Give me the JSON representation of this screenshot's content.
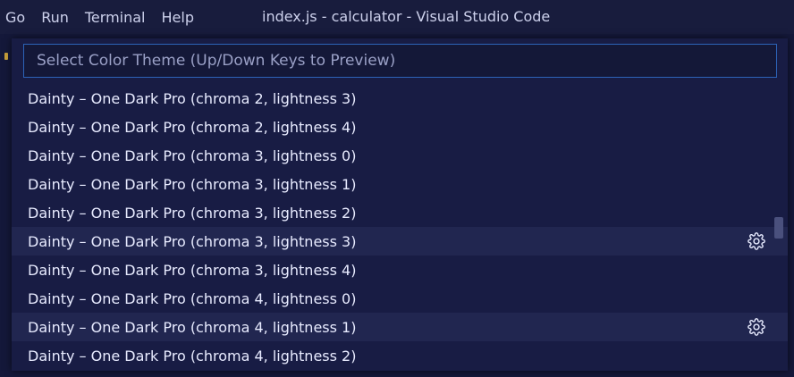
{
  "menubar": {
    "items": [
      "Go",
      "Run",
      "Terminal",
      "Help"
    ],
    "window_title": "index.js - calculator - Visual Studio Code"
  },
  "picker": {
    "placeholder": "Select Color Theme (Up/Down Keys to Preview)",
    "items": [
      {
        "label": "Dainty – One Dark Pro (chroma 2, lightness 3)",
        "show_gear": false
      },
      {
        "label": "Dainty – One Dark Pro (chroma 2, lightness 4)",
        "show_gear": false
      },
      {
        "label": "Dainty – One Dark Pro (chroma 3, lightness 0)",
        "show_gear": false
      },
      {
        "label": "Dainty – One Dark Pro (chroma 3, lightness 1)",
        "show_gear": false
      },
      {
        "label": "Dainty – One Dark Pro (chroma 3, lightness 2)",
        "show_gear": false
      },
      {
        "label": "Dainty – One Dark Pro (chroma 3, lightness 3)",
        "show_gear": true
      },
      {
        "label": "Dainty – One Dark Pro (chroma 3, lightness 4)",
        "show_gear": false
      },
      {
        "label": "Dainty – One Dark Pro (chroma 4, lightness 0)",
        "show_gear": false
      },
      {
        "label": "Dainty – One Dark Pro (chroma 4, lightness 1)",
        "show_gear": true
      },
      {
        "label": "Dainty – One Dark Pro (chroma 4, lightness 2)",
        "show_gear": false
      }
    ]
  },
  "icons": {
    "gear": "gear-icon"
  },
  "colors": {
    "background": "#181c3d",
    "picker_background": "#181c44",
    "hover_row": "#212650",
    "input_border": "#2d63b8",
    "text": "#e8ebff"
  }
}
